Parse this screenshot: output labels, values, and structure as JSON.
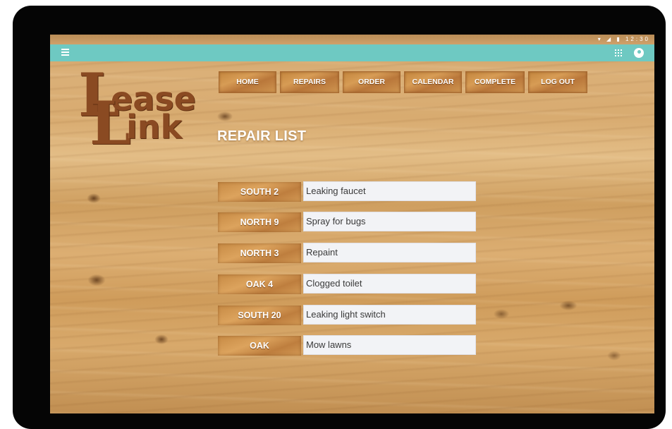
{
  "app": {
    "logo_line1": "ease",
    "logo_line2": "ink",
    "logo_initial1": "L",
    "logo_initial2": "L"
  },
  "status_bar": {
    "icons": "▾ ◢ ▮ 12:30"
  },
  "nav": {
    "items": [
      {
        "label": "HOME"
      },
      {
        "label": "REPAIRS"
      },
      {
        "label": "ORDER"
      },
      {
        "label": "CALENDAR"
      },
      {
        "label": "COMPLETE"
      },
      {
        "label": "LOG OUT"
      }
    ]
  },
  "page": {
    "title": "REPAIR LIST"
  },
  "repairs": [
    {
      "unit": "SOUTH 2",
      "description": "Leaking faucet"
    },
    {
      "unit": "NORTH 9",
      "description": "Spray for bugs"
    },
    {
      "unit": "NORTH 3",
      "description": "Repaint"
    },
    {
      "unit": "OAK 4",
      "description": "Clogged toilet"
    },
    {
      "unit": "SOUTH 20",
      "description": "Leaking light switch"
    },
    {
      "unit": "OAK",
      "description": "Mow lawns"
    }
  ],
  "colors": {
    "app_bar": "#6ec9c2",
    "logo": "#8a4a22",
    "field_bg": "#f2f3f6"
  },
  "icons": {
    "menu": "menu-icon",
    "apps": "apps-grid-icon",
    "account": "account-icon"
  }
}
